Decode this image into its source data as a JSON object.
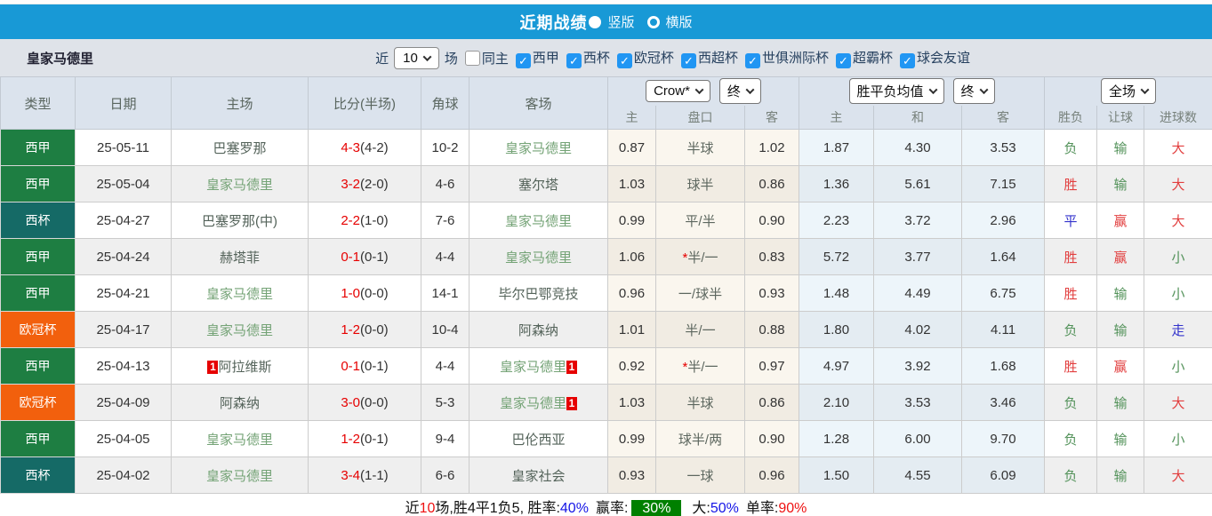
{
  "colors": {
    "header_blue": "#1899d6",
    "laliga_green": "#1e7e42",
    "copa_teal": "#156a66",
    "ucl_orange": "#f2600d",
    "score_red": "#e60000",
    "result_red": "#e23e3e",
    "result_green": "#53925a",
    "result_blue": "#3333cc",
    "team_self_green": "#74a376",
    "team_opp_green": "#54635a",
    "summary_blue": "#1414e6",
    "summary_red": "#ee1111",
    "badge_green": "#008000",
    "checkbox_blue": "#2196f3"
  },
  "header": {
    "title": "近期战绩",
    "vertical_label": "竖版",
    "horizontal_label": "横版"
  },
  "filter": {
    "team": "皇家马德里",
    "near": "近",
    "count": "10",
    "games": "场",
    "same_home": "同主",
    "competitions": [
      "西甲",
      "西杯",
      "欧冠杯",
      "西超杯",
      "世俱洲际杯",
      "超霸杯",
      "球会友谊"
    ]
  },
  "table": {
    "left_headers": [
      "类型",
      "日期",
      "主场",
      "比分(半场)",
      "角球",
      "客场"
    ],
    "selects": {
      "company": "Crow*",
      "company_state": "终",
      "wdl": "胜平负均值",
      "wdl_state": "终",
      "scope": "全场"
    },
    "sub_headers": [
      "主",
      "盘口",
      "客",
      "主",
      "和",
      "客",
      "胜负",
      "让球",
      "进球数"
    ],
    "rows": [
      {
        "type": "西甲",
        "type_class": "laliga",
        "date": "25-05-11",
        "home": "巴塞罗那",
        "home_class": "opp",
        "home_card": "",
        "score": "4-3",
        "half": "(4-2)",
        "corner": "10-2",
        "away": "皇家马德里",
        "away_class": "self",
        "away_card": "",
        "h": "0.87",
        "hcp_star": "",
        "hcp": "半球",
        "a": "1.02",
        "w": "1.87",
        "d": "4.30",
        "l": "3.53",
        "res": "负",
        "res_c": "green",
        "lres": "输",
        "lres_c": "green",
        "gres": "大",
        "gres_c": "red"
      },
      {
        "type": "西甲",
        "type_class": "laliga",
        "date": "25-05-04",
        "home": "皇家马德里",
        "home_class": "self",
        "home_card": "",
        "score": "3-2",
        "half": "(2-0)",
        "corner": "4-6",
        "away": "塞尔塔",
        "away_class": "opp",
        "away_card": "",
        "h": "1.03",
        "hcp_star": "",
        "hcp": "球半",
        "a": "0.86",
        "w": "1.36",
        "d": "5.61",
        "l": "7.15",
        "res": "胜",
        "res_c": "red",
        "lres": "输",
        "lres_c": "green",
        "gres": "大",
        "gres_c": "red"
      },
      {
        "type": "西杯",
        "type_class": "copa",
        "date": "25-04-27",
        "home": "巴塞罗那(中)",
        "home_class": "opp",
        "home_card": "",
        "score": "2-2",
        "half": "(1-0)",
        "corner": "7-6",
        "away": "皇家马德里",
        "away_class": "self",
        "away_card": "",
        "h": "0.99",
        "hcp_star": "",
        "hcp": "平/半",
        "a": "0.90",
        "w": "2.23",
        "d": "3.72",
        "l": "2.96",
        "res": "平",
        "res_c": "blue",
        "lres": "赢",
        "lres_c": "red",
        "gres": "大",
        "gres_c": "red"
      },
      {
        "type": "西甲",
        "type_class": "laliga",
        "date": "25-04-24",
        "home": "赫塔菲",
        "home_class": "opp",
        "home_card": "",
        "score": "0-1",
        "half": "(0-1)",
        "corner": "4-4",
        "away": "皇家马德里",
        "away_class": "self",
        "away_card": "",
        "h": "1.06",
        "hcp_star": "*",
        "hcp": "半/一",
        "a": "0.83",
        "w": "5.72",
        "d": "3.77",
        "l": "1.64",
        "res": "胜",
        "res_c": "red",
        "lres": "赢",
        "lres_c": "red",
        "gres": "小",
        "gres_c": "green"
      },
      {
        "type": "西甲",
        "type_class": "laliga",
        "date": "25-04-21",
        "home": "皇家马德里",
        "home_class": "self",
        "home_card": "",
        "score": "1-0",
        "half": "(0-0)",
        "corner": "14-1",
        "away": "毕尔巴鄂竞技",
        "away_class": "opp",
        "away_card": "",
        "h": "0.96",
        "hcp_star": "",
        "hcp": "一/球半",
        "a": "0.93",
        "w": "1.48",
        "d": "4.49",
        "l": "6.75",
        "res": "胜",
        "res_c": "red",
        "lres": "输",
        "lres_c": "green",
        "gres": "小",
        "gres_c": "green"
      },
      {
        "type": "欧冠杯",
        "type_class": "ucl",
        "date": "25-04-17",
        "home": "皇家马德里",
        "home_class": "self",
        "home_card": "",
        "score": "1-2",
        "half": "(0-0)",
        "corner": "10-4",
        "away": "阿森纳",
        "away_class": "opp",
        "away_card": "",
        "h": "1.01",
        "hcp_star": "",
        "hcp": "半/一",
        "a": "0.88",
        "w": "1.80",
        "d": "4.02",
        "l": "4.11",
        "res": "负",
        "res_c": "green",
        "lres": "输",
        "lres_c": "green",
        "gres": "走",
        "gres_c": "blue"
      },
      {
        "type": "西甲",
        "type_class": "laliga",
        "date": "25-04-13",
        "home": "阿拉维斯",
        "home_class": "opp",
        "home_card": "1",
        "score": "0-1",
        "half": "(0-1)",
        "corner": "4-4",
        "away": "皇家马德里",
        "away_class": "self",
        "away_card": "1",
        "h": "0.92",
        "hcp_star": "*",
        "hcp": "半/一",
        "a": "0.97",
        "w": "4.97",
        "d": "3.92",
        "l": "1.68",
        "res": "胜",
        "res_c": "red",
        "lres": "赢",
        "lres_c": "red",
        "gres": "小",
        "gres_c": "green"
      },
      {
        "type": "欧冠杯",
        "type_class": "ucl",
        "date": "25-04-09",
        "home": "阿森纳",
        "home_class": "opp",
        "home_card": "",
        "score": "3-0",
        "half": "(0-0)",
        "corner": "5-3",
        "away": "皇家马德里",
        "away_class": "self",
        "away_card": "1",
        "h": "1.03",
        "hcp_star": "",
        "hcp": "半球",
        "a": "0.86",
        "w": "2.10",
        "d": "3.53",
        "l": "3.46",
        "res": "负",
        "res_c": "green",
        "lres": "输",
        "lres_c": "green",
        "gres": "大",
        "gres_c": "red"
      },
      {
        "type": "西甲",
        "type_class": "laliga",
        "date": "25-04-05",
        "home": "皇家马德里",
        "home_class": "self",
        "home_card": "",
        "score": "1-2",
        "half": "(0-1)",
        "corner": "9-4",
        "away": "巴伦西亚",
        "away_class": "opp",
        "away_card": "",
        "h": "0.99",
        "hcp_star": "",
        "hcp": "球半/两",
        "a": "0.90",
        "w": "1.28",
        "d": "6.00",
        "l": "9.70",
        "res": "负",
        "res_c": "green",
        "lres": "输",
        "lres_c": "green",
        "gres": "小",
        "gres_c": "green"
      },
      {
        "type": "西杯",
        "type_class": "copa",
        "date": "25-04-02",
        "home": "皇家马德里",
        "home_class": "self",
        "home_card": "",
        "score": "3-4",
        "half": "(1-1)",
        "corner": "6-6",
        "away": "皇家社会",
        "away_class": "opp",
        "away_card": "",
        "h": "0.93",
        "hcp_star": "",
        "hcp": "一球",
        "a": "0.96",
        "w": "1.50",
        "d": "4.55",
        "l": "6.09",
        "res": "负",
        "res_c": "green",
        "lres": "输",
        "lres_c": "green",
        "gres": "大",
        "gres_c": "red"
      }
    ]
  },
  "summary": {
    "near": "近",
    "count": "10",
    "record": "场,胜4平1负5, 胜率:",
    "win_rate": "40%",
    "profit_label": "赢率:",
    "profit_rate": "30%",
    "big_label": "大:",
    "big_rate": "50%",
    "single_label": "单率:",
    "single_rate": "90%"
  }
}
